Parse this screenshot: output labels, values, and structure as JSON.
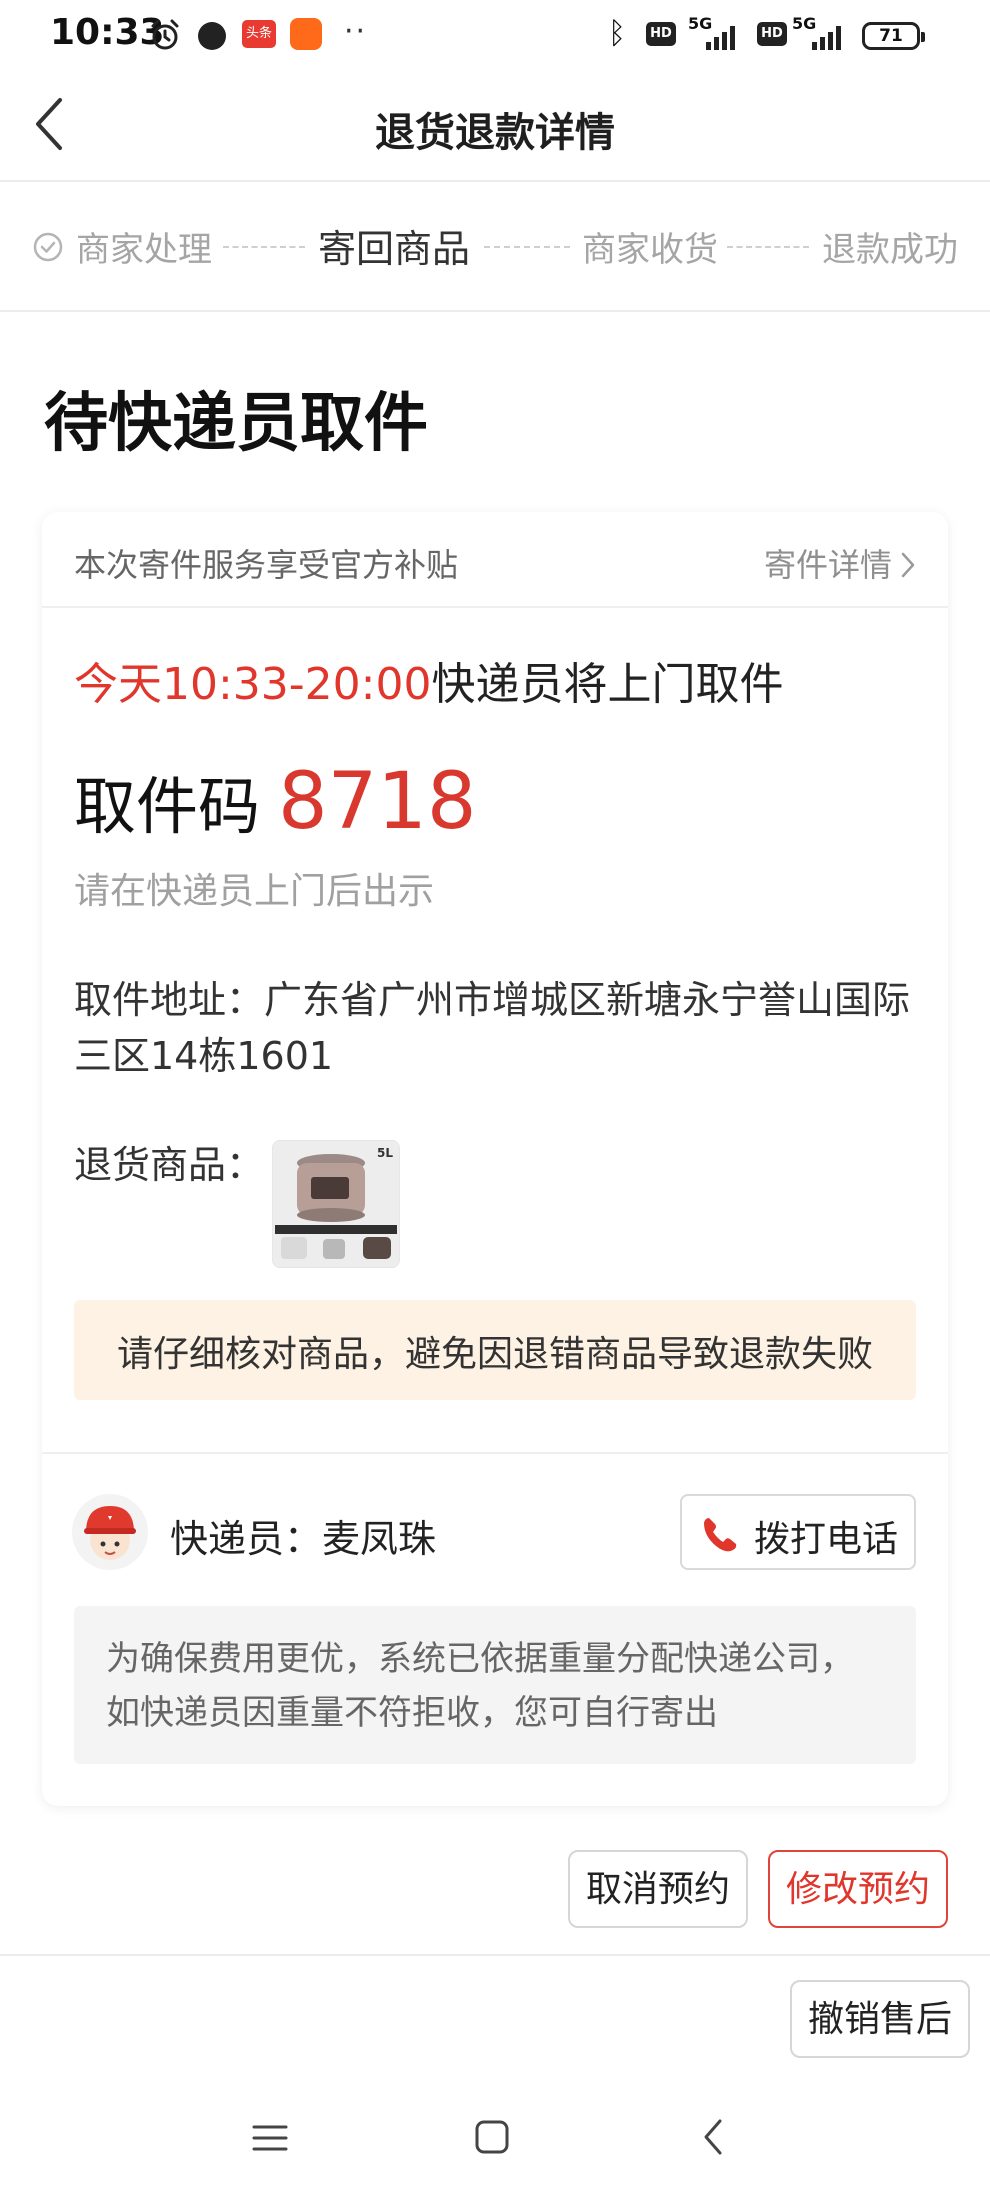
{
  "status_bar": {
    "time": "10:33",
    "toutiao_label": "头条",
    "more": "··",
    "network_label_1": "5G",
    "network_label_2": "5G",
    "hd_label": "HD",
    "battery": "71"
  },
  "header": {
    "title": "退货退款详情"
  },
  "steps": [
    {
      "label": "商家处理",
      "state": "done"
    },
    {
      "label": "寄回商品",
      "state": "active"
    },
    {
      "label": "商家收货",
      "state": "pending"
    },
    {
      "label": "退款成功",
      "state": "pending"
    }
  ],
  "status_heading": "待快递员取件",
  "card": {
    "subsidy_text": "本次寄件服务享受官方补贴",
    "detail_link": "寄件详情",
    "pickup_time_red": "今天10:33-20:00",
    "pickup_time_rest": "快递员将上门取件",
    "code_label": "取件码",
    "code_value": "8718",
    "code_hint": "请在快递员上门后出示",
    "address_label": "取件地址：",
    "address_value": "广东省广州市增城区新塘永宁誉山国际三区14栋1601",
    "goods_label": "退货商品：",
    "goods_thumb_badge": "5L",
    "warning": "请仔细核对商品，避免因退错商品导致退款失败",
    "courier_label": "快递员：",
    "courier_name": "麦凤珠",
    "call_button": "拨打电话",
    "notice": "为确保费用更优，系统已依据重量分配快递公司，如快递员因重量不符拒收，您可自行寄出"
  },
  "actions": {
    "cancel_booking": "取消预约",
    "modify_booking": "修改预约",
    "revoke_aftersale": "撤销售后"
  },
  "colors": {
    "accent_red": "#e0362c",
    "warning_bg": "#fdf2e3",
    "notice_bg": "#f4f4f4",
    "muted_text": "#a5a5a5"
  },
  "icons": [
    "alarm-icon",
    "bluetooth-icon",
    "signal-icon",
    "battery-icon",
    "back-arrow-icon",
    "check-circle-icon",
    "chevron-right-icon",
    "phone-icon",
    "courier-avatar",
    "nav-menu-icon",
    "nav-home-icon",
    "nav-back-icon"
  ]
}
